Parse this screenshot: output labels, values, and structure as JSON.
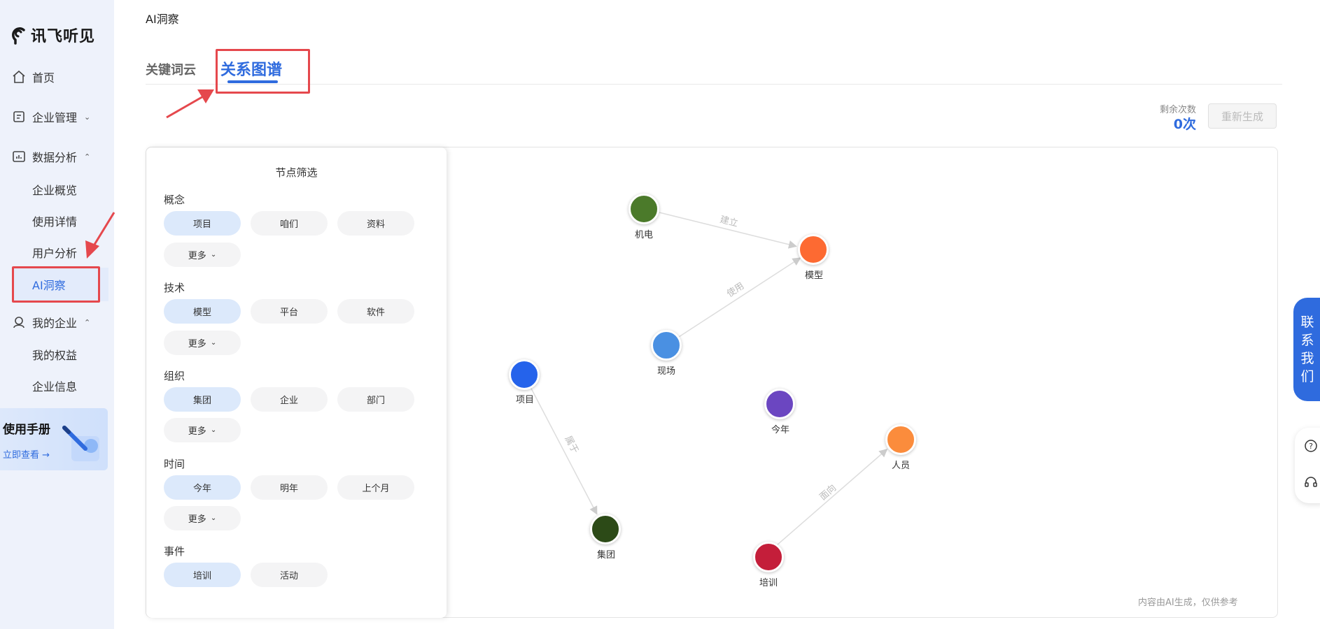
{
  "app": {
    "name": "讯飞听见"
  },
  "sidebar": {
    "home": "首页",
    "enterprise_mgmt": "企业管理",
    "data_analysis": "数据分析",
    "analysis_items": [
      "企业概览",
      "使用详情",
      "用户分析",
      "AI洞察"
    ],
    "my_enterprise": "我的企业",
    "enterprise_items": [
      "我的权益",
      "企业信息"
    ],
    "manual": {
      "title": "使用手册",
      "link": "立即查看 →"
    }
  },
  "breadcrumb": "AI洞察",
  "tabs": [
    "关键词云",
    "关系图谱"
  ],
  "quota": {
    "label": "剩余次数",
    "value": "0次",
    "button": "重新生成"
  },
  "filter": {
    "title": "节点筛选",
    "more": "更多",
    "groups": [
      {
        "label": "概念",
        "chips": [
          "项目",
          "咱们",
          "资料"
        ]
      },
      {
        "label": "技术",
        "chips": [
          "模型",
          "平台",
          "软件"
        ]
      },
      {
        "label": "组织",
        "chips": [
          "集团",
          "企业",
          "部门"
        ]
      },
      {
        "label": "时间",
        "chips": [
          "今年",
          "明年",
          "上个月"
        ]
      },
      {
        "label": "事件",
        "chips": [
          "培训",
          "活动"
        ]
      }
    ]
  },
  "graph": {
    "nodes": [
      {
        "label": "机电",
        "color": "#4b7a2a"
      },
      {
        "label": "模型",
        "color": "#fd6a32"
      },
      {
        "label": "现场",
        "color": "#4a90e2"
      },
      {
        "label": "项目",
        "color": "#2563eb"
      },
      {
        "label": "今年",
        "color": "#6b46c1"
      },
      {
        "label": "人员",
        "color": "#fb8c3c"
      },
      {
        "label": "集团",
        "color": "#2c4a17"
      },
      {
        "label": "培训",
        "color": "#c41e3a"
      }
    ],
    "edges": [
      {
        "from": "机电",
        "to": "模型",
        "label": "建立"
      },
      {
        "from": "现场",
        "to": "模型",
        "label": "使用"
      },
      {
        "from": "项目",
        "to": "集团",
        "label": "属于"
      },
      {
        "from": "培训",
        "to": "人员",
        "label": "面向"
      }
    ],
    "note": "内容由AI生成，仅供参考"
  },
  "contact": "联系我们",
  "colors": {
    "accent": "#2f6bde",
    "highlight": "#e5484d"
  }
}
